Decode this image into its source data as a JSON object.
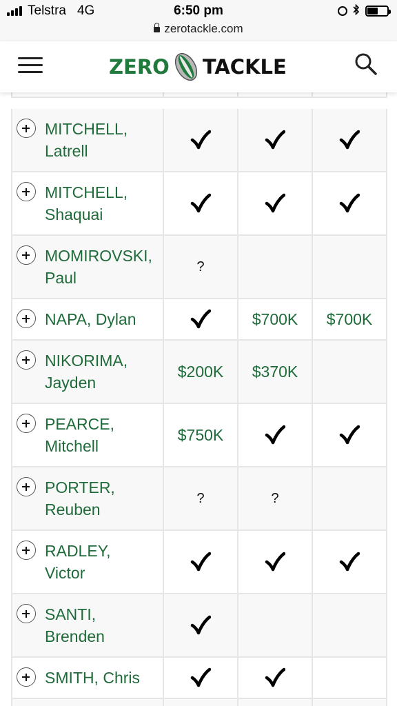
{
  "status_bar": {
    "carrier": "Telstra",
    "network": "4G",
    "time": "6:50 pm",
    "battery_level": 0.55
  },
  "browser": {
    "url": "zerotackle.com"
  },
  "header": {
    "logo_left": "ZERO",
    "logo_right": "TACKLE",
    "menu_icon": "hamburger-menu-icon",
    "search_icon": "search-icon"
  },
  "colors": {
    "brand_green": "#1f7a3c",
    "link_green": "#1f6b3a",
    "border": "#e6e6e6"
  },
  "table": {
    "rows": [
      {
        "line1": "",
        "line2": "",
        "cells": [
          "",
          "",
          ""
        ]
      },
      {
        "line1": "MITCHELL,",
        "line2": "Latrell",
        "cells": [
          "✓",
          "✓",
          "✓"
        ]
      },
      {
        "line1": "MITCHELL,",
        "line2": "Shaquai",
        "cells": [
          "✓",
          "✓",
          "✓"
        ]
      },
      {
        "line1": "MOMIROVSKI,",
        "line2": "Paul",
        "cells": [
          "?",
          "",
          ""
        ]
      },
      {
        "line1": "NAPA, Dylan",
        "line2": "",
        "cells": [
          "✓",
          "$700K",
          "$700K"
        ]
      },
      {
        "line1": "NIKORIMA,",
        "line2": "Jayden",
        "cells": [
          "$200K",
          "$370K",
          ""
        ]
      },
      {
        "line1": "PEARCE,",
        "line2": "Mitchell",
        "cells": [
          "$750K",
          "✓",
          "✓"
        ]
      },
      {
        "line1": "PORTER,",
        "line2": "Reuben",
        "cells": [
          "?",
          "?",
          ""
        ]
      },
      {
        "line1": "RADLEY,",
        "line2": "Victor",
        "cells": [
          "✓",
          "✓",
          "✓"
        ]
      },
      {
        "line1": "SANTI,",
        "line2": "Brenden",
        "cells": [
          "✓",
          "",
          ""
        ]
      },
      {
        "line1": "SMITH, Chris",
        "line2": "",
        "cells": [
          "✓",
          "✓",
          ""
        ]
      },
      {
        "line1": "",
        "line2": "",
        "cells": [
          "",
          "",
          ""
        ]
      }
    ]
  }
}
